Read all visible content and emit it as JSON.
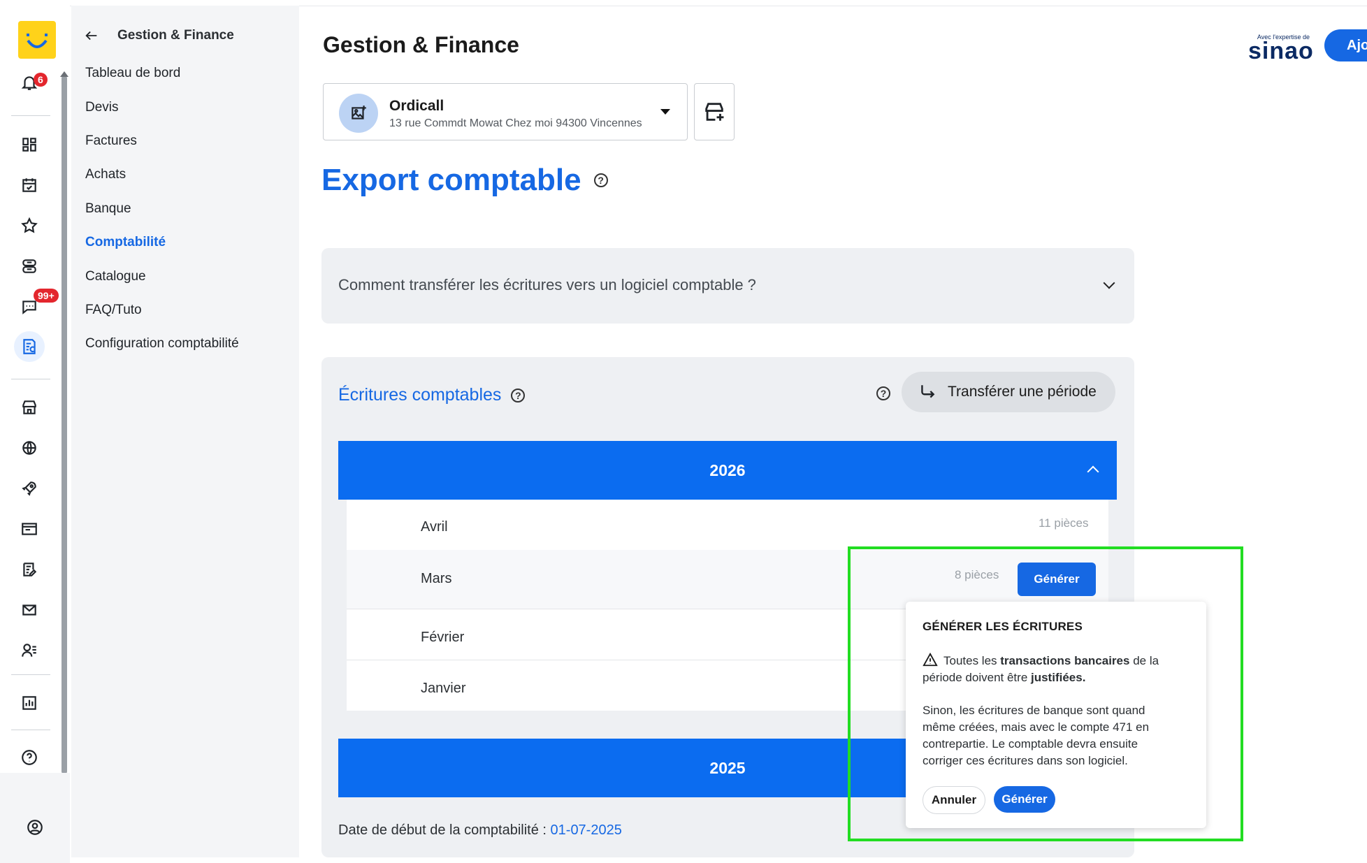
{
  "badges": {
    "notifications": "6",
    "messages": "99+"
  },
  "sidebar_icons": [
    "notification-bell-icon",
    "dashboard-icon",
    "calendar-icon",
    "star-icon",
    "tickets-icon",
    "chat-icon",
    "accounting-doc-icon",
    "shop-icon",
    "globe-icon",
    "rocket-icon",
    "browser-icon",
    "edit-list-icon",
    "mail-icon",
    "contacts-icon",
    "report-icon",
    "help-icon",
    "user-circle-icon"
  ],
  "subnav": {
    "title": "Gestion & Finance",
    "items": [
      {
        "label": "Tableau de bord"
      },
      {
        "label": "Devis"
      },
      {
        "label": "Factures"
      },
      {
        "label": "Achats"
      },
      {
        "label": "Banque"
      },
      {
        "label": "Comptabilité",
        "active": true
      },
      {
        "label": "Catalogue"
      },
      {
        "label": "FAQ/Tuto"
      },
      {
        "label": "Configuration comptabilité"
      }
    ]
  },
  "header": {
    "title": "Gestion & Finance",
    "brand_small": "Avec l'expertise de",
    "brand": "sinao",
    "add_button": "Ajo"
  },
  "company": {
    "name": "Ordicall",
    "address": "13 rue Commdt Mowat Chez moi 94300 Vincennes"
  },
  "export": {
    "title": "Export comptable",
    "faq_question": "Comment transférer les écritures vers un logiciel comptable ?",
    "section_title": "Écritures comptables",
    "transfer_button": "Transférer une période",
    "years": [
      "2026",
      "2025"
    ],
    "months": [
      {
        "name": "Avril",
        "pieces": "11 pièces"
      },
      {
        "name": "Mars",
        "pieces": "8 pièces",
        "action": "Générer"
      },
      {
        "name": "Février"
      },
      {
        "name": "Janvier"
      }
    ],
    "start_date_label": "Date de début de la comptabilité : ",
    "start_date_value": "01-07-2025"
  },
  "popover": {
    "title": "GÉNÉRER LES ÉCRITURES",
    "warn_pre": "Toutes les ",
    "warn_bold1": "transactions bancaires",
    "warn_mid": " de la période doivent être ",
    "warn_bold2": "justifiées.",
    "body": "Sinon, les écritures de banque sont quand même créées, mais avec le compte 471 en contrepartie. Le comptable devra ensuite corriger ces écritures dans son logiciel.",
    "cancel": "Annuler",
    "confirm": "Générer"
  },
  "colors": {
    "accent": "#1668e3",
    "year_bar": "#0b6cf0",
    "highlight": "#22dd22",
    "logo": "#ffd21a"
  }
}
